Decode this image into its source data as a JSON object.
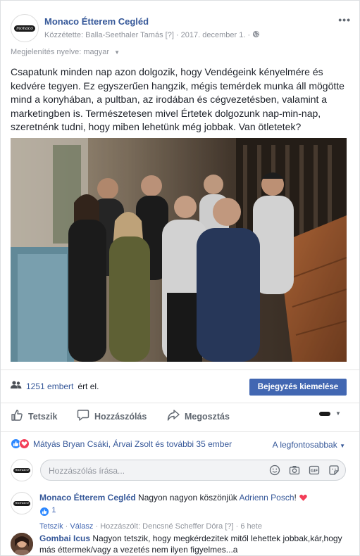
{
  "post": {
    "page_name": "Monaco Étterem Cegléd",
    "meta_prefix": "Közzétette:",
    "author": "Balla-Seethaler Tamás",
    "author_tag": "[?]",
    "dot": "·",
    "date": "2017. december 1.",
    "audience_icon": "globe-icon",
    "logo_text": "monaco",
    "language_label": "Megjelenítés nyelve: magyar",
    "text": "Csapatunk minden nap azon dolgozik, hogy Vendégeink kényelmére és kedvére tegyen. Ez egyszerűen hangzik, mégis temérdek munka áll mögötte mind a konyhában, a pultban, az irodában és cégvezetésben, valamint a marketingben is. Természetesen mivel Értetek dolgozunk nap-min-nap, szeretnénk tudni, hogy miben lehetünk még jobbak. Van ötletetek?"
  },
  "reach": {
    "count_text": "1251 embert",
    "suffix": "ért el.",
    "boost_label": "Bejegyzés kiemelése"
  },
  "actions": {
    "like": "Tetszik",
    "comment": "Hozzászólás",
    "share": "Megosztás"
  },
  "reactions": {
    "summary": "Mátyás Bryan Csáki, Árvai Zsolt és további 35 ember",
    "sort_label": "A legfontosabbak"
  },
  "comment_box": {
    "placeholder": "Hozzászólás írása..."
  },
  "comments": [
    {
      "author": "Monaco Étterem Cegléd",
      "text_before": "Nagyon nagyon köszönjük",
      "mention": "Adrienn Posch",
      "text_after": "!",
      "like_count": "1",
      "like_label": "Tetszik",
      "reply_label": "Válasz",
      "by_prefix": "Hozzászólt:",
      "by_name": "Dencsné Scheffer Dóra",
      "by_tag": "[?]",
      "time": "6 hete"
    },
    {
      "author": "Gombai Icus",
      "text": "Nagyon tetszik, hogy megkérdezitek mitől lehettek jobbak,kár,hogy más éttermek/vagy a vezetés nem ilyen figyelmes...a"
    }
  ],
  "colors": {
    "link": "#365899",
    "primary": "#4267b2",
    "muted": "#90949c",
    "like_blue": "#2d88ff",
    "love_red": "#f33e58"
  }
}
